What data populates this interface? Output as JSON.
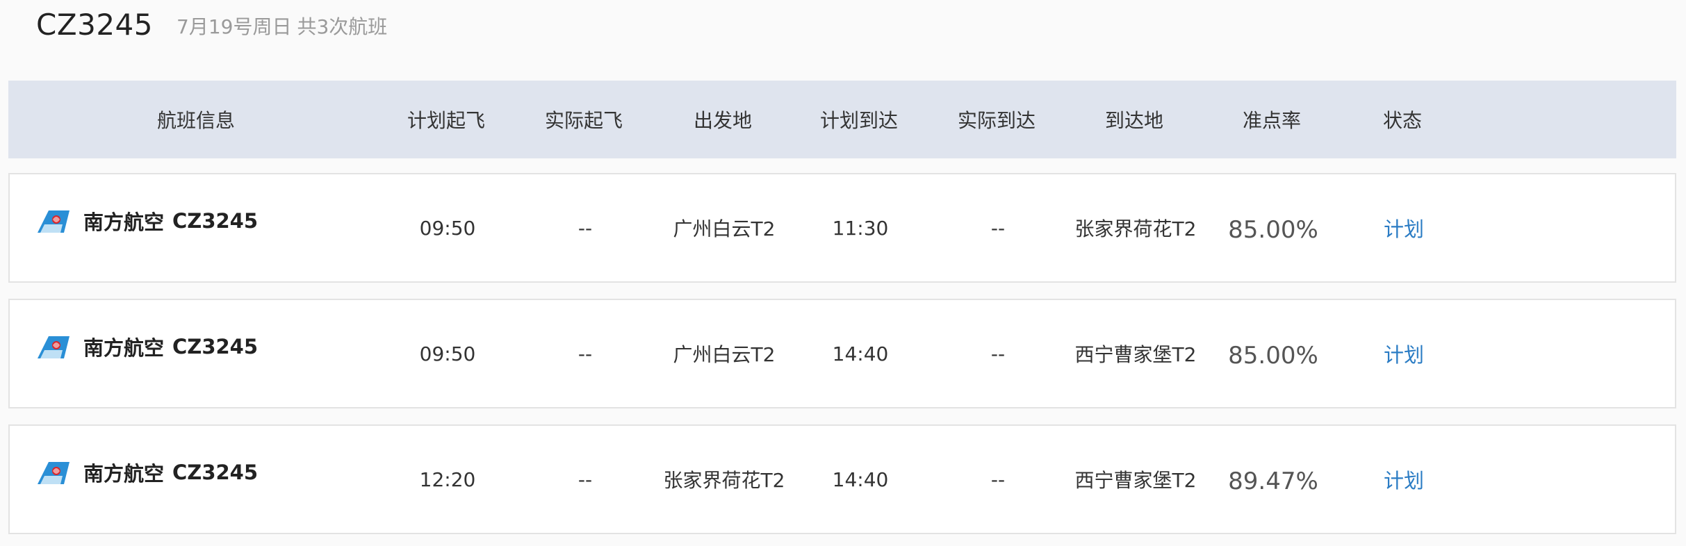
{
  "header": {
    "flight_no": "CZ3245",
    "date": "7月19号周日",
    "count": "共3次航班"
  },
  "columns": {
    "info": "航班信息",
    "dep_plan": "计划起飞",
    "dep_actual": "实际起飞",
    "from": "出发地",
    "arr_plan": "计划到达",
    "arr_actual": "实际到达",
    "to": "到达地",
    "ontime_rate": "准点率",
    "status": "状态"
  },
  "colors": {
    "header_bg": "#dfe4ee",
    "status_link": "#2b7cc4",
    "logo_blue": "#2a8fd6",
    "logo_red": "#d9262c"
  },
  "flights": [
    {
      "logo_icon": "china-southern-logo",
      "airline": "南方航空",
      "flight_no": "CZ3245",
      "dep_plan": "09:50",
      "dep_actual": "--",
      "from": "广州白云T2",
      "arr_plan": "11:30",
      "arr_actual": "--",
      "to": "张家界荷花T2",
      "ontime_rate": "85.00%",
      "status": "计划"
    },
    {
      "logo_icon": "china-southern-logo",
      "airline": "南方航空",
      "flight_no": "CZ3245",
      "dep_plan": "09:50",
      "dep_actual": "--",
      "from": "广州白云T2",
      "arr_plan": "14:40",
      "arr_actual": "--",
      "to": "西宁曹家堡T2",
      "ontime_rate": "85.00%",
      "status": "计划"
    },
    {
      "logo_icon": "china-southern-logo",
      "airline": "南方航空",
      "flight_no": "CZ3245",
      "dep_plan": "12:20",
      "dep_actual": "--",
      "from": "张家界荷花T2",
      "arr_plan": "14:40",
      "arr_actual": "--",
      "to": "西宁曹家堡T2",
      "ontime_rate": "89.47%",
      "status": "计划"
    }
  ]
}
